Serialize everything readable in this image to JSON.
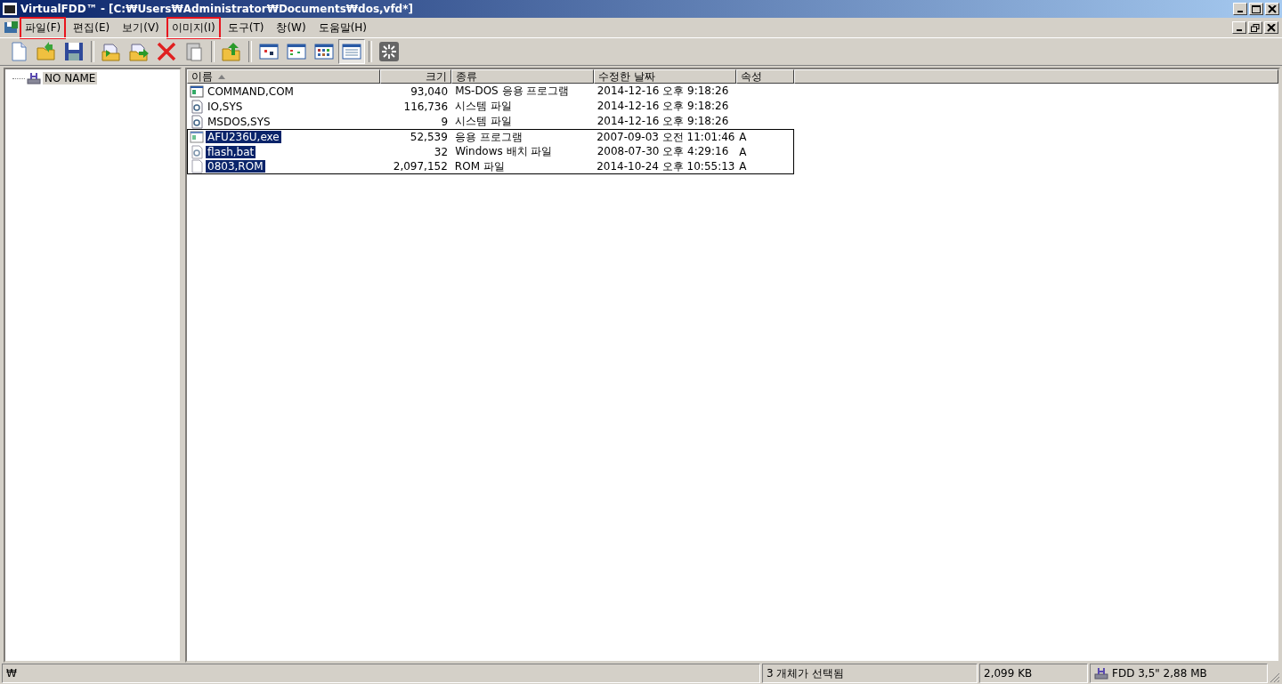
{
  "window": {
    "title": "VirtualFDD™ - [C:₩Users₩Administrator₩Documents₩dos,vfd*]"
  },
  "menu": [
    {
      "label": "파일(F)",
      "highlighted": true
    },
    {
      "label": "편집(E)",
      "highlighted": false
    },
    {
      "label": "보기(V)",
      "highlighted": false
    },
    {
      "label": "이미지(I)",
      "highlighted": true
    },
    {
      "label": "도구(T)",
      "highlighted": false
    },
    {
      "label": "창(W)",
      "highlighted": false
    },
    {
      "label": "도움말(H)",
      "highlighted": false
    }
  ],
  "toolbar": [
    {
      "kind": "new",
      "pressed": false
    },
    {
      "kind": "open",
      "pressed": false
    },
    {
      "kind": "save",
      "pressed": false
    },
    {
      "kind": "sep"
    },
    {
      "kind": "import",
      "pressed": false
    },
    {
      "kind": "export",
      "pressed": false
    },
    {
      "kind": "delete",
      "pressed": false
    },
    {
      "kind": "paste",
      "pressed": false
    },
    {
      "kind": "sep"
    },
    {
      "kind": "up",
      "pressed": false
    },
    {
      "kind": "sep"
    },
    {
      "kind": "largeicons",
      "pressed": false
    },
    {
      "kind": "smallicons",
      "pressed": false
    },
    {
      "kind": "list",
      "pressed": false
    },
    {
      "kind": "details",
      "pressed": true
    },
    {
      "kind": "sep"
    },
    {
      "kind": "burst",
      "pressed": false
    }
  ],
  "tree": {
    "items": [
      {
        "label": "NO NAME",
        "selected": true
      }
    ]
  },
  "table": {
    "columns": [
      {
        "label": "이름",
        "sorted": true
      },
      {
        "label": "크기",
        "sorted": false
      },
      {
        "label": "종류",
        "sorted": false
      },
      {
        "label": "수정한 날짜",
        "sorted": false
      },
      {
        "label": "속성",
        "sorted": false
      }
    ],
    "rows": [
      {
        "kind": "program",
        "name": "COMMAND,COM",
        "size": "93,040",
        "type": "MS-DOS 응용 프로그램",
        "date": "2014-12-16 오후 9:18:26",
        "selected": false
      },
      {
        "kind": "system",
        "name": "IO,SYS",
        "size": "116,736",
        "type": "시스템 파일",
        "date": "2014-12-16 오후 9:18:26",
        "selected": false
      },
      {
        "kind": "system",
        "name": "MSDOS,SYS",
        "size": "9",
        "type": "시스템 파일",
        "date": "2014-12-16 오후 9:18:26",
        "selected": false
      },
      {
        "kind": "program",
        "name": "AFU236U,exe",
        "size": "52,539",
        "type": "응용 프로그램",
        "date": "2007-09-03 오전 11:01:46",
        "attr": "A",
        "selected": true
      },
      {
        "kind": "system",
        "name": "flash,bat",
        "size": "32",
        "type": "Windows 배치 파일",
        "date": "2008-07-30 오후 4:29:16",
        "attr": "A",
        "selected": true
      },
      {
        "kind": "blank",
        "name": "0803,ROM",
        "size": "2,097,152",
        "type": "ROM 파일",
        "date": "2014-10-24 오후 10:55:13",
        "attr": "A",
        "selected": true
      }
    ]
  },
  "status_bar": {
    "path": "₩",
    "selection": "3 개체가 선택됨",
    "size": "2,099 KB",
    "disk": "FDD 3,5\" 2,88 MB"
  }
}
